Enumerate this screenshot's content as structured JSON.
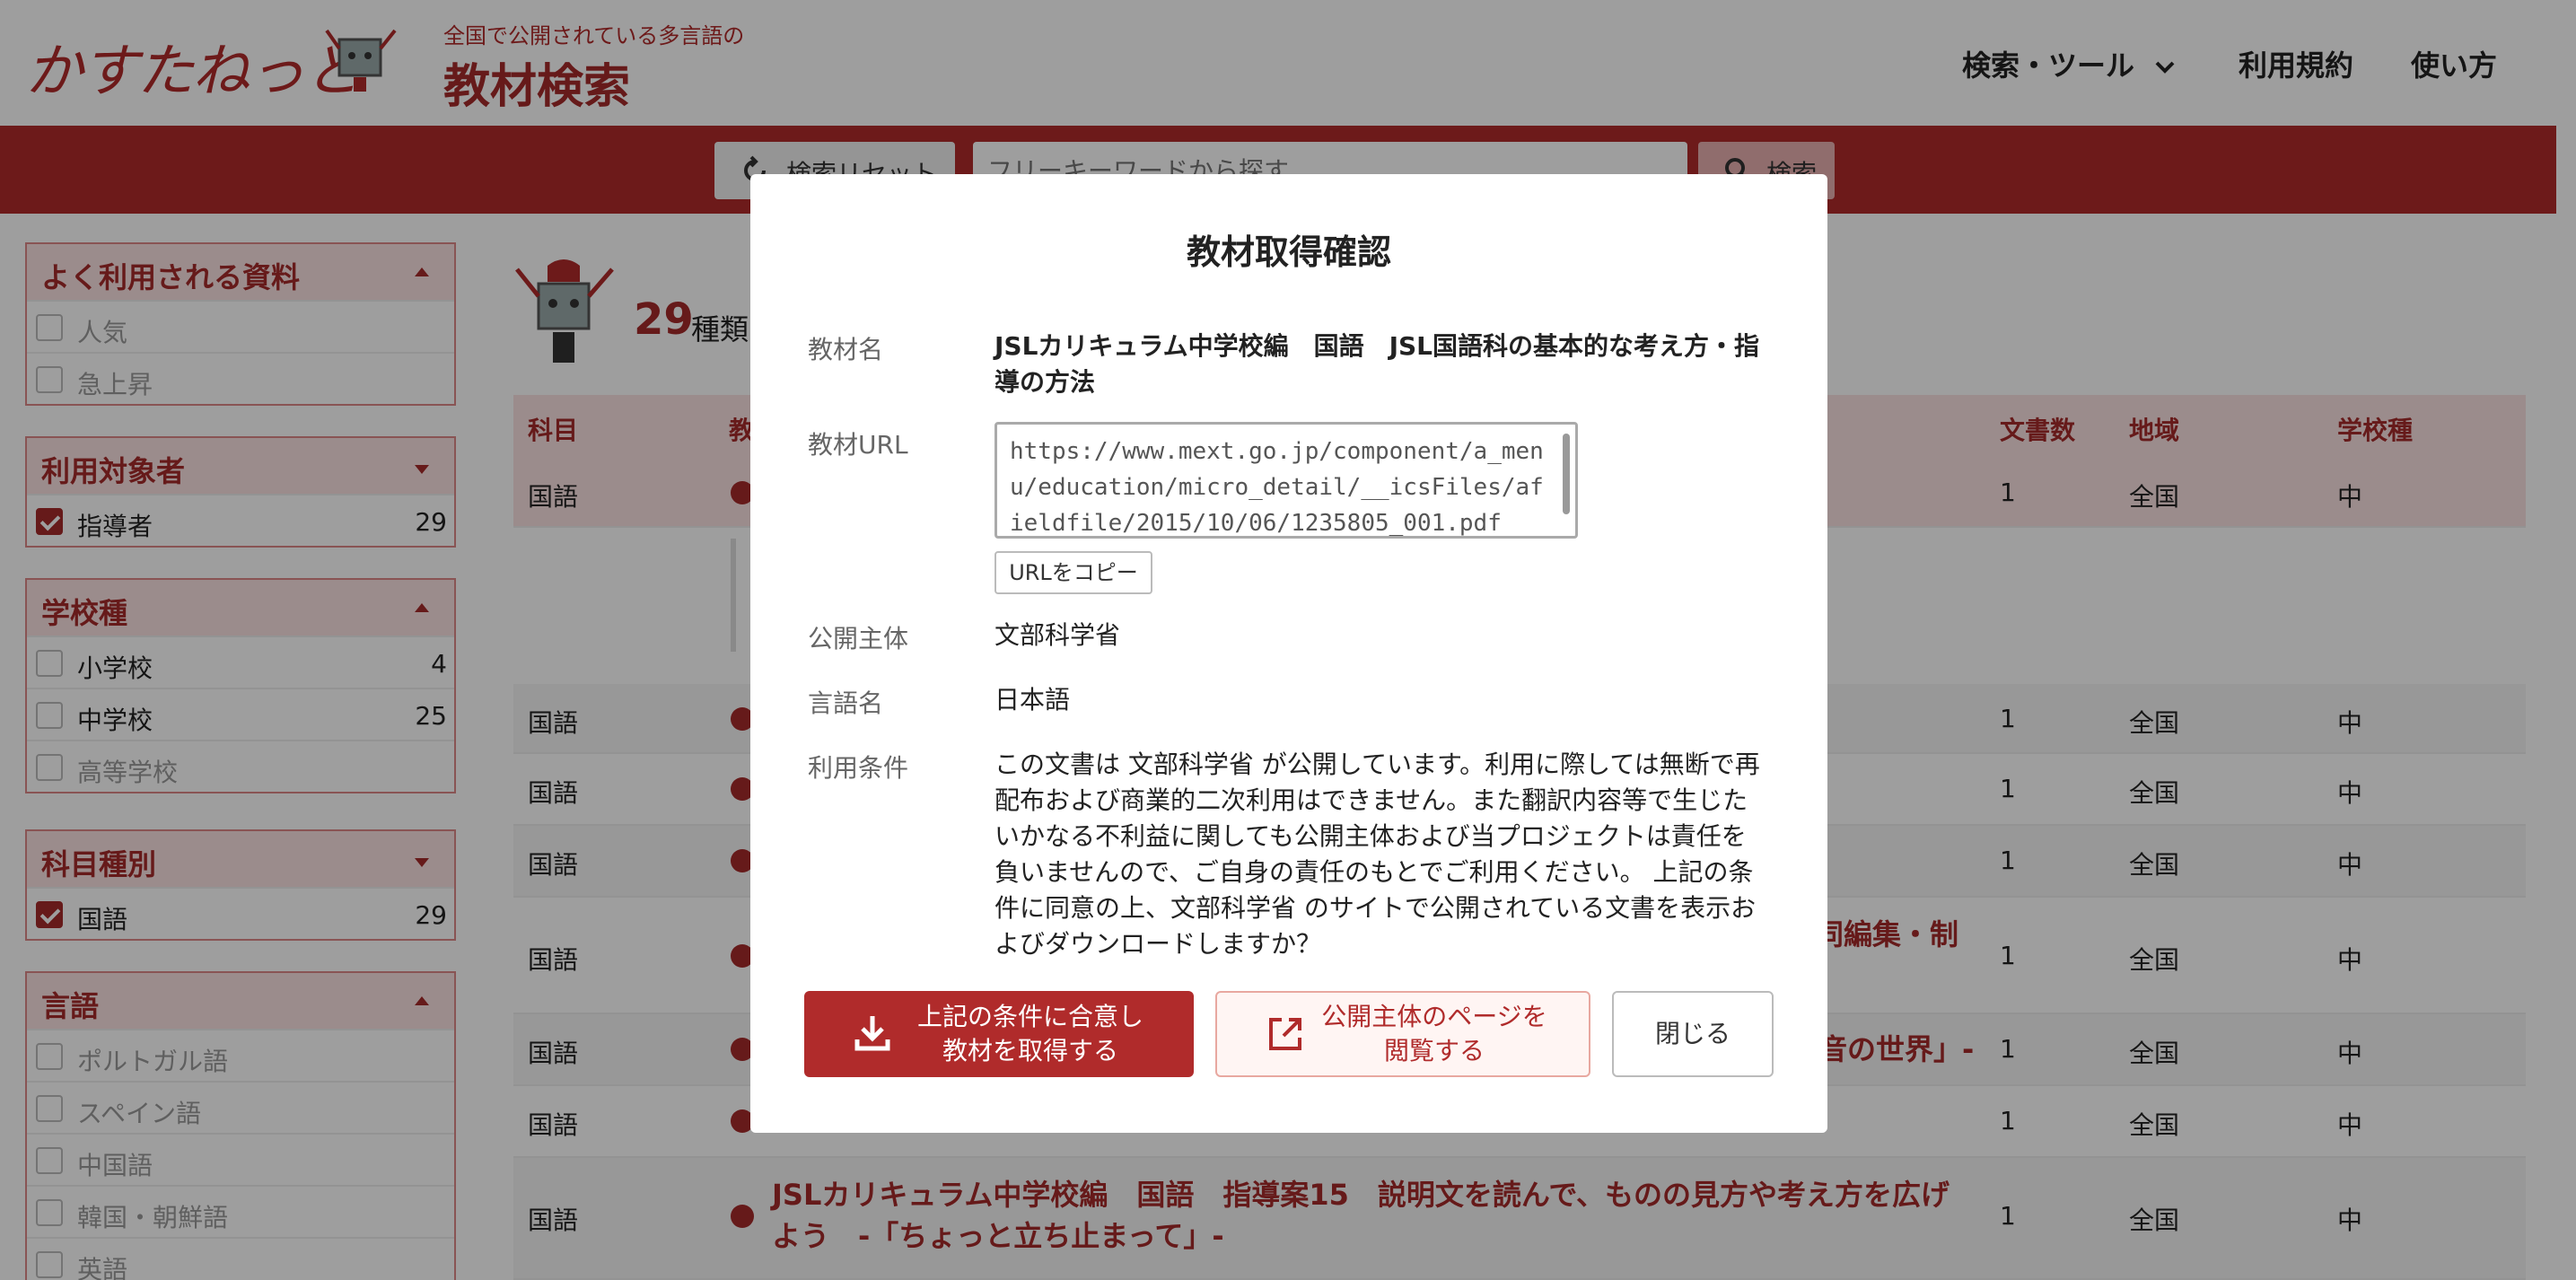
{
  "header": {
    "logo_text": "かすたねっと",
    "subtitle": "全国で公開されている多言語の",
    "title": "教材検索",
    "nav": {
      "tools": "検索・ツール",
      "terms": "利用規約",
      "howto": "使い方"
    }
  },
  "search": {
    "reset_label": "検索リセット",
    "placeholder": "フリーキーワードから探す",
    "button_label": "検索"
  },
  "sidebar": {
    "popular": {
      "title": "よく利用される資料",
      "items": [
        {
          "label": "人気"
        },
        {
          "label": "急上昇"
        }
      ]
    },
    "audience": {
      "title": "利用対象者",
      "items": [
        {
          "label": "指導者",
          "count": "29"
        }
      ]
    },
    "school": {
      "title": "学校種",
      "items": [
        {
          "label": "小学校",
          "count": "4"
        },
        {
          "label": "中学校",
          "count": "25"
        },
        {
          "label": "高等学校"
        }
      ]
    },
    "subject": {
      "title": "科目種別",
      "items": [
        {
          "label": "国語",
          "count": "29"
        }
      ]
    },
    "language": {
      "title": "言語",
      "items": [
        {
          "label": "ポルトガル語"
        },
        {
          "label": "スペイン語"
        },
        {
          "label": "中国語"
        },
        {
          "label": "韓国・朝鮮語"
        },
        {
          "label": "英語"
        }
      ]
    }
  },
  "results": {
    "count": "29",
    "unit": "種類",
    "columns": {
      "subject": "科目",
      "material": "教",
      "docs": "文書数",
      "region": "地域",
      "school": "学校種"
    },
    "rows": [
      {
        "subject": "国語",
        "title": "",
        "docs": "1",
        "region": "全国",
        "school": "中"
      },
      {
        "subject": "国語",
        "title": "",
        "docs": "1",
        "region": "全国",
        "school": "中"
      },
      {
        "subject": "国語",
        "title": "",
        "docs": "1",
        "region": "全国",
        "school": "中"
      },
      {
        "subject": "国語",
        "title": "",
        "docs": "1",
        "region": "全国",
        "school": "中"
      },
      {
        "subject": "国語",
        "title": "同編集・制",
        "docs": "1",
        "region": "全国",
        "school": "中"
      },
      {
        "subject": "国語",
        "title": "音の世界」-",
        "docs": "1",
        "region": "全国",
        "school": "中"
      },
      {
        "subject": "国語",
        "title": "",
        "docs": "1",
        "region": "全国",
        "school": "中"
      },
      {
        "subject": "国語",
        "title_line1": "JSLカリキュラム中学校編　国語　指導案15　説明文を読んで、ものの見方や考え方を広げ",
        "title_line2": "よう　-「ちょっと立ち止まって」-",
        "docs": "1",
        "region": "全国",
        "school": "中"
      }
    ]
  },
  "modal": {
    "title": "教材取得確認",
    "labels": {
      "name": "教材名",
      "url": "教材URL",
      "publisher": "公開主体",
      "language": "言語名",
      "terms": "利用条件"
    },
    "name": "JSLカリキュラム中学校編　国語　JSL国語科の基本的な考え方・指導の方法",
    "url": "https://www.mext.go.jp/component/a_menu/education/micro_detail/__icsFiles/afieldfile/2015/10/06/1235805_001.pdf",
    "copy_label": "URLをコピー",
    "publisher": "文部科学省",
    "language": "日本語",
    "terms": "この文書は 文部科学省 が公開しています。利用に際しては無断で再配布および商業的二次利用はできません。また翻訳内容等で生じたいかなる不利益に関しても公開主体および当プロジェクトは責任を負いませんので、ご自身の責任のもとでご利用ください。 上記の条件に同意の上、文部科学省 のサイトで公開されている文書を表示およびダウンロードしますか？",
    "buttons": {
      "agree_line1": "上記の条件に合意し",
      "agree_line2": "教材を取得する",
      "publisher_line1": "公開主体のページを",
      "publisher_line2": "閲覧する",
      "close": "閉じる"
    }
  },
  "colors": {
    "brand_red": "#b02b2b",
    "light_red": "#fbe3e3",
    "overlay": "rgba(0,0,0,0.38)"
  }
}
